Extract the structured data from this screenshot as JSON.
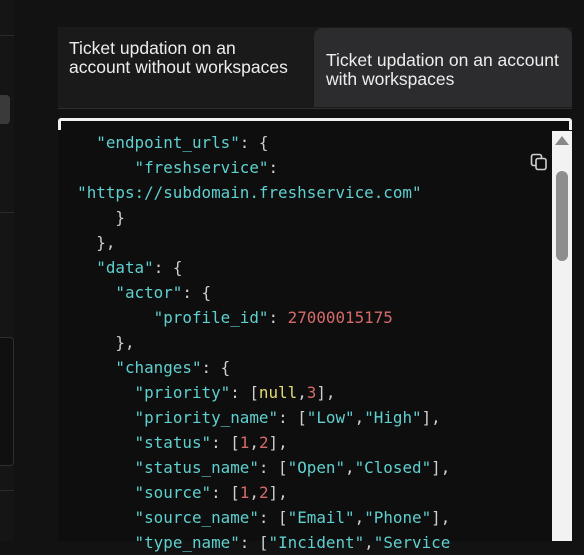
{
  "tabs": [
    {
      "label": "Ticket updation on an account without workspaces",
      "active": false
    },
    {
      "label": "Ticket updation on an account with workspaces",
      "active": true
    }
  ],
  "code": {
    "language": "json",
    "lines": [
      [
        {
          "t": "    "
        },
        {
          "t": "\"endpoint_urls\"",
          "c": "k"
        },
        {
          "t": ": {"
        }
      ],
      [
        {
          "t": "        "
        },
        {
          "t": "\"freshservice\"",
          "c": "k"
        },
        {
          "t": ":"
        }
      ],
      [
        {
          "t": "  "
        },
        {
          "t": "\"https://subdomain.freshservice.com\"",
          "c": "s"
        }
      ],
      [
        {
          "t": "      }"
        }
      ],
      [
        {
          "t": "    },"
        }
      ],
      [
        {
          "t": "    "
        },
        {
          "t": "\"data\"",
          "c": "k"
        },
        {
          "t": ": {"
        }
      ],
      [
        {
          "t": "      "
        },
        {
          "t": "\"actor\"",
          "c": "k"
        },
        {
          "t": ": {"
        }
      ],
      [
        {
          "t": "          "
        },
        {
          "t": "\"profile_id\"",
          "c": "k"
        },
        {
          "t": ": "
        },
        {
          "t": "27000015175",
          "c": "n"
        }
      ],
      [
        {
          "t": "      },"
        }
      ],
      [
        {
          "t": "      "
        },
        {
          "t": "\"changes\"",
          "c": "k"
        },
        {
          "t": ": {"
        }
      ],
      [
        {
          "t": "        "
        },
        {
          "t": "\"priority\"",
          "c": "k"
        },
        {
          "t": ": ["
        },
        {
          "t": "null",
          "c": "kw"
        },
        {
          "t": ","
        },
        {
          "t": "3",
          "c": "n"
        },
        {
          "t": "],"
        }
      ],
      [
        {
          "t": "        "
        },
        {
          "t": "\"priority_name\"",
          "c": "k"
        },
        {
          "t": ": ["
        },
        {
          "t": "\"Low\"",
          "c": "s"
        },
        {
          "t": ","
        },
        {
          "t": "\"High\"",
          "c": "s"
        },
        {
          "t": "],"
        }
      ],
      [
        {
          "t": "        "
        },
        {
          "t": "\"status\"",
          "c": "k"
        },
        {
          "t": ": ["
        },
        {
          "t": "1",
          "c": "n"
        },
        {
          "t": ","
        },
        {
          "t": "2",
          "c": "n"
        },
        {
          "t": "],"
        }
      ],
      [
        {
          "t": "        "
        },
        {
          "t": "\"status_name\"",
          "c": "k"
        },
        {
          "t": ": ["
        },
        {
          "t": "\"Open\"",
          "c": "s"
        },
        {
          "t": ","
        },
        {
          "t": "\"Closed\"",
          "c": "s"
        },
        {
          "t": "],"
        }
      ],
      [
        {
          "t": "        "
        },
        {
          "t": "\"source\"",
          "c": "k"
        },
        {
          "t": ": ["
        },
        {
          "t": "1",
          "c": "n"
        },
        {
          "t": ","
        },
        {
          "t": "2",
          "c": "n"
        },
        {
          "t": "],"
        }
      ],
      [
        {
          "t": "        "
        },
        {
          "t": "\"source_name\"",
          "c": "k"
        },
        {
          "t": ": ["
        },
        {
          "t": "\"Email\"",
          "c": "s"
        },
        {
          "t": ","
        },
        {
          "t": "\"Phone\"",
          "c": "s"
        },
        {
          "t": "],"
        }
      ],
      [
        {
          "t": "        "
        },
        {
          "t": "\"type_name\"",
          "c": "k"
        },
        {
          "t": ": ["
        },
        {
          "t": "\"Incident\"",
          "c": "s"
        },
        {
          "t": ","
        },
        {
          "t": "\"Service",
          "c": "s"
        }
      ]
    ]
  },
  "icons": {
    "copy": "copy-icon",
    "scroll_up": "arrow-up-icon"
  },
  "colors": {
    "key": "#5fd0cf",
    "number": "#d66a6a",
    "keyword": "#e6db74",
    "background": "#0e0e0e"
  }
}
